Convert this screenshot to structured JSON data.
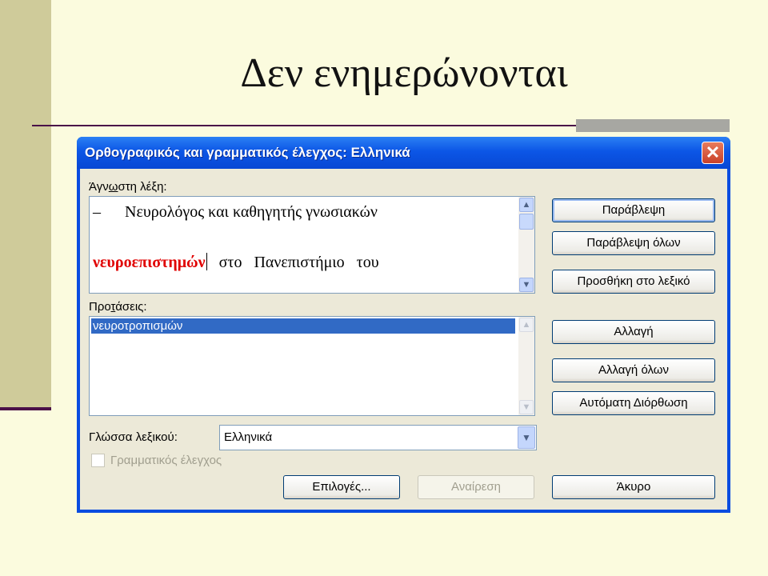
{
  "slide": {
    "title": "Δεν ενημερώνονται"
  },
  "dialog": {
    "title": "Ορθογραφικός και γραμματικός έλεγχος: Ελληνικά",
    "close_glyph": "✕",
    "unknown_word_label_pre": "Άγν",
    "unknown_word_label_key": "ω",
    "unknown_word_label_post": "στη λέξη:",
    "sentence_line1": "–      Νευρολόγος και καθηγητής γνωσιακών",
    "error_word": "νευροεπιστημών",
    "sentence_line2_rest": "   στο   Πανεπιστήμιο   του",
    "suggestions_label_pre": "Προ",
    "suggestions_label_key": "τ",
    "suggestions_label_post": "άσεις:",
    "suggestions": [
      "νευροτροπισμών"
    ],
    "language_label": "Γλώσσα λεξικού:",
    "language_value": "Ελληνικά",
    "grammar_check_label": "Γραμματικός έλεγχος",
    "buttons": {
      "ignore": "Παράβλεψη",
      "ignore_all": "Παράβλεψη όλων",
      "add_to_dictionary": "Προσθήκη στο λεξικό",
      "change": "Αλλαγή",
      "change_all": "Αλλαγή όλων",
      "autocorrect": "Αυτόματη Διόρθωση",
      "options": "Επιλογές...",
      "undo": "Αναίρεση",
      "cancel": "Άκυρο"
    }
  },
  "colors": {
    "slide_background": "#fbfbde",
    "side_bar": "#cfcb9a",
    "accent_line": "#4a1048",
    "titlebar": "#0c56e6",
    "error_word": "#e00000",
    "selection": "#316ac5"
  },
  "icons": {
    "scroll_up": "chevron-up-icon",
    "scroll_down": "chevron-down-icon",
    "combo": "chevron-down-icon",
    "close": "close-icon"
  }
}
